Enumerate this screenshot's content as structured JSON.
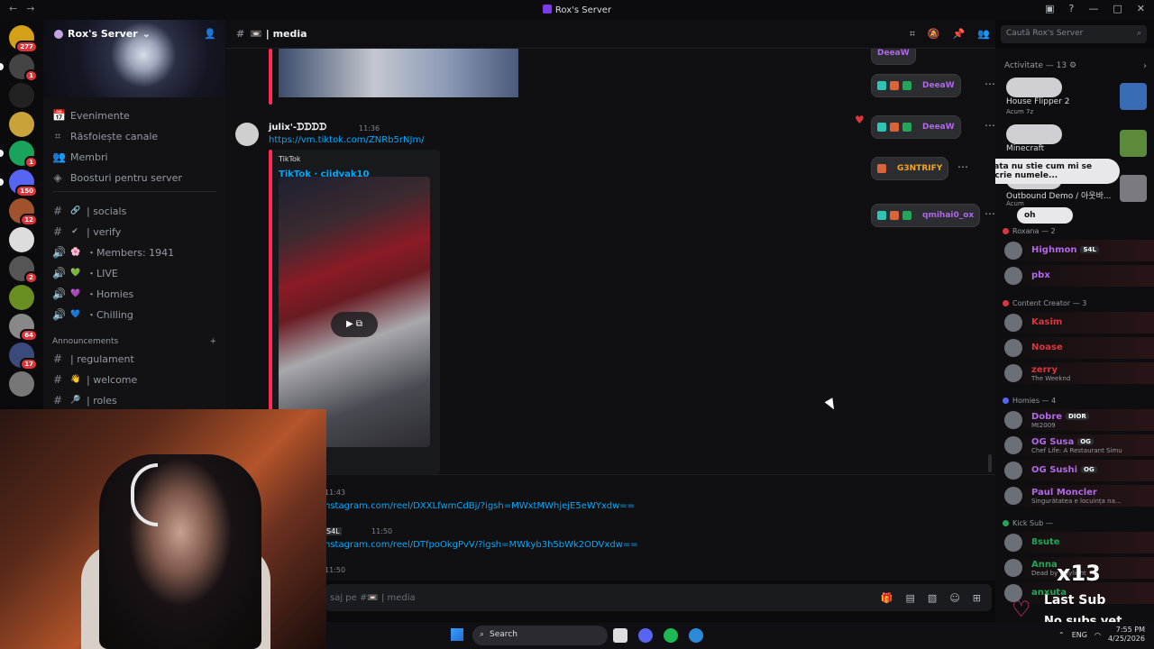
{
  "titlebar": {
    "title": "Rox's Server"
  },
  "server_list": [
    {
      "badge": "277"
    },
    {
      "badge": "1"
    },
    {
      "badge": ""
    },
    {
      "badge": ""
    },
    {
      "badge": "1"
    },
    {
      "badge": "150"
    },
    {
      "badge": "12"
    },
    {
      "badge": ""
    },
    {
      "badge": "2"
    },
    {
      "badge": ""
    },
    {
      "badge": "64"
    },
    {
      "badge": "17"
    },
    {
      "badge": ""
    }
  ],
  "sidebar": {
    "server_name": "Rox's Server",
    "menu": [
      {
        "label": "Evenimente"
      },
      {
        "label": "Răsfoiește canale"
      },
      {
        "label": "Membri"
      },
      {
        "label": "Boosturi pentru server"
      }
    ],
    "channels": [
      {
        "label": "| socials",
        "emoji": "🔗"
      },
      {
        "label": "| verify",
        "emoji": "✔"
      },
      {
        "label": "・Members: 1941",
        "emoji": "🌸"
      },
      {
        "label": "・LIVE",
        "emoji": "💚"
      },
      {
        "label": "・Homies",
        "emoji": "💜"
      },
      {
        "label": "・Chilling",
        "emoji": "💙"
      }
    ],
    "category": "Announcements",
    "ann_channels": [
      {
        "label": "| regulament"
      },
      {
        "label": "| welcome",
        "emoji": "👋"
      },
      {
        "label": "| roles",
        "emoji": "🔎"
      }
    ]
  },
  "header": {
    "channel": "| media"
  },
  "search": {
    "placeholder": "Caută Rox's Server"
  },
  "messages": {
    "reactions_top": [
      {
        "label": "DeeaW",
        "color": "#b067e8"
      }
    ],
    "message1": {
      "username": "julix'-ᗪᗪᗪᗪ",
      "time": "11:36",
      "link": "https://vm.tiktok.com/ZNRb5rNJm/",
      "embed_provider": "TikTok",
      "embed_title": "TikTok · ciidyak10"
    },
    "reactions": [
      {
        "label": "DeeaW",
        "color": "#b067e8"
      },
      {
        "label": "G3NTRIFY",
        "color": "#f5a524"
      },
      {
        "label": "qmihai0_ox",
        "color": "#b067e8"
      }
    ],
    "later": [
      {
        "time": "11:43",
        "link": "nstagram.com/reel/DXXLfwmCdBj/?igsh=MWxtMWhjejE5eWYxdw=="
      },
      {
        "time": "11:50",
        "tag": "S4L",
        "link": "nstagram.com/reel/DTfpoOkgPvV/?igsh=MWkyb3h5bWk2ODVxdw=="
      },
      {
        "time": "11:50"
      }
    ]
  },
  "composer": {
    "placeholder": "saj pe #📼 | media"
  },
  "members": {
    "activity_header": "Activitate — 13",
    "activities": [
      {
        "title": "House Flipper 2",
        "sub": "Acum 7z"
      },
      {
        "title": "Minecraft",
        "sub": ""
      },
      {
        "title": "Outbound Demo / 아웃바...",
        "sub": "Acum"
      }
    ],
    "bubbles": [
      {
        "text": "tata nu stie cum mi se scrie numele..."
      },
      {
        "text": "oh"
      }
    ],
    "groups": [
      {
        "name": "Roxana — 2",
        "dot": "#da373c",
        "members": [
          {
            "name": "Highmon",
            "color": "#b067e8",
            "tag": "S4L",
            "sub": ""
          },
          {
            "name": "pbx",
            "color": "#b067e8",
            "tag": "",
            "sub": ""
          }
        ]
      },
      {
        "name": "Content Creator — 3",
        "dot": "#da373c",
        "members": [
          {
            "name": "Kasim",
            "color": "#da373c",
            "tag": "",
            "sub": ""
          },
          {
            "name": "Noase",
            "color": "#da373c",
            "tag": "",
            "sub": ""
          },
          {
            "name": "zerry",
            "color": "#da373c",
            "tag": "",
            "sub": "The Weeknd"
          }
        ]
      },
      {
        "name": "Homies — 4",
        "dot": "#5865f2",
        "members": [
          {
            "name": "Dobre",
            "color": "#b067e8",
            "tag": "DIOR",
            "sub": "Mt2009"
          },
          {
            "name": "OG Susa",
            "color": "#b067e8",
            "tag": "OG",
            "sub": "Chef Life: A Restaurant Simu"
          },
          {
            "name": "OG Sushi",
            "color": "#b067e8",
            "tag": "OG",
            "sub": ""
          },
          {
            "name": "Paul Moncler",
            "color": "#b067e8",
            "tag": "",
            "sub": "Singurătatea e locuința na..."
          }
        ]
      },
      {
        "name": "Kick Sub —",
        "dot": "#23a55a",
        "members": [
          {
            "name": "8sute",
            "color": "#23a55a",
            "tag": "",
            "sub": ""
          },
          {
            "name": "Anna",
            "color": "#23a55a",
            "tag": "",
            "sub": "Dead by Daylight"
          },
          {
            "name": "anxuta",
            "color": "#23a55a",
            "tag": "",
            "sub": ""
          }
        ]
      }
    ]
  },
  "overlay": {
    "count": "x13",
    "last_sub": "Last Sub",
    "no_subs": "No subs yet"
  },
  "taskbar": {
    "search": "Search",
    "lang": "ENG",
    "time": "7:55 PM",
    "date": "4/25/2026"
  }
}
